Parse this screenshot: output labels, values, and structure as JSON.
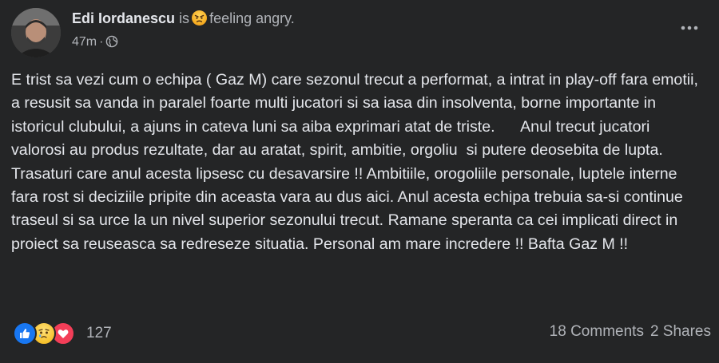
{
  "header": {
    "author": "Edi Iordanescu",
    "is_text": "is",
    "feeling": "feeling angry.",
    "time": "47m",
    "separator": "·"
  },
  "post": {
    "text": "E trist sa vezi cum o echipa ( Gaz M) care sezonul trecut a performat, a intrat in play-off fara emotii, a resusit sa vanda in paralel foarte multi jucatori si sa iasa din insolventa, borne importante in istoricul clubului, a ajuns in cateva luni sa aiba exprimari atat de triste.      Anul trecut jucatori valorosi au produs rezultate, dar au aratat, spirit, ambitie, orgoliu  si putere deosebita de lupta. Trasaturi care anul acesta lipsesc cu desavarsire !! Ambitiile, orogoliile personale, luptele interne fara rost si deciziile pripite din aceasta vara au dus aici. Anul acesta echipa trebuia sa-si continue traseul si sa urce la un nivel superior sezonului trecut. Ramane speranta ca cei implicati direct in proiect sa reuseasca sa redreseze situatia. Personal am mare incredere !! Bafta Gaz M !!"
  },
  "footer": {
    "reaction_icons": [
      "like-icon",
      "sad-icon",
      "love-icon"
    ],
    "reaction_count": "127",
    "comments": "18 Comments",
    "shares": "2 Shares"
  },
  "colors": {
    "background": "#242526",
    "text_primary": "#e4e6eb",
    "text_secondary": "#b0b3b8",
    "like_blue": "#1877f2",
    "love_red": "#f33e58"
  }
}
